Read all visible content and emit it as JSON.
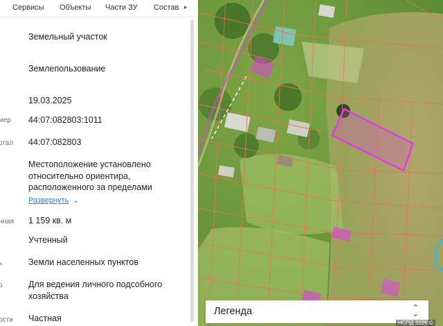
{
  "tabs": [
    "Сервисы",
    "Объекты",
    "Части ЗУ",
    "Состав"
  ],
  "rows": [
    {
      "label": "",
      "value": "Земельный участок"
    },
    {
      "label": "",
      "value": "Землепользование"
    },
    {
      "label": "",
      "value": "19.03.2025"
    },
    {
      "label": "мер",
      "value": "44:07:082803:1011"
    },
    {
      "label": "ртал",
      "value": "44:07:082803"
    },
    {
      "label": "",
      "value": "Местоположение установлено относительно ориентира, расположенного за пределами"
    },
    {
      "label": "нная",
      "value": "1 159 кв. м"
    },
    {
      "label": "",
      "value": "Учтенный"
    },
    {
      "label": "ь",
      "value": "Земли населенных пунктов"
    },
    {
      "label": "о",
      "value": "Для ведения личного подсобного хозяйства"
    },
    {
      "label": "ости",
      "value": "Частная"
    }
  ],
  "expand_label": "Развернуть",
  "legend_label": "Легенда",
  "copyright": "НСПД 2026 ©",
  "colors": {
    "parcel_selected": "#e040e0",
    "parcel_border": "#e8735a",
    "link": "#2a7cdd"
  }
}
